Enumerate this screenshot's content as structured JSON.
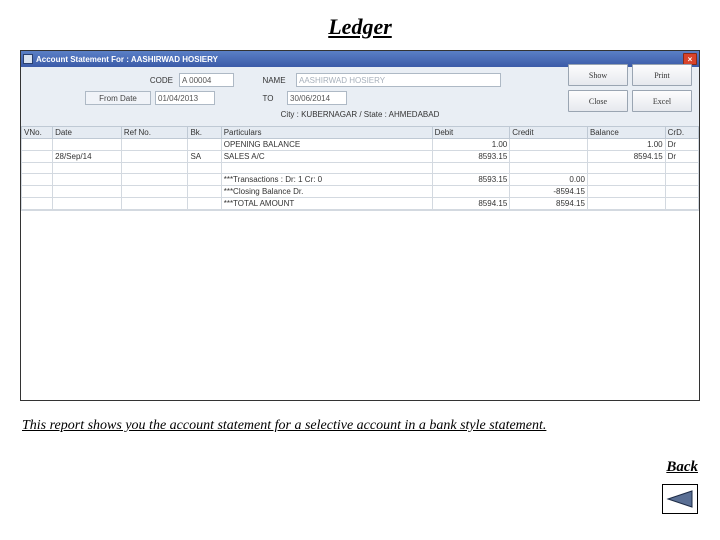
{
  "title": "Ledger",
  "window": {
    "title": "Account Statement For : AASHIRWAD HOSIERY",
    "form": {
      "code_label": "CODE",
      "code_value": "A 00004",
      "name_label": "NAME",
      "name_value": "AASHIRWAD HOSIERY",
      "from_date_label": "From Date",
      "from_date_value": "01/04/2013",
      "to_label": "TO",
      "to_date_value": "30/06/2014",
      "city_line": "City : KUBERNAGAR / State : AHMEDABAD"
    },
    "buttons": {
      "show": "Show",
      "print": "Print",
      "close": "Close",
      "excel": "Excel"
    },
    "columns": {
      "no": "VNo.",
      "date": "Date",
      "ref": "Ref No.",
      "bk": "Bk.",
      "part": "Particulars",
      "debit": "Debit",
      "credit": "Credit",
      "balance": "Balance",
      "crdr": "CrD."
    },
    "rows": [
      {
        "no": "",
        "date": "",
        "ref": "",
        "bk": "",
        "part": "OPENING BALANCE",
        "debit": "1.00",
        "credit": "",
        "bal": "1.00",
        "cd": "Dr"
      },
      {
        "no": "",
        "date": "28/Sep/14",
        "ref": "",
        "bk": "SA",
        "part": "SALES A/C",
        "debit": "8593.15",
        "credit": "",
        "bal": "8594.15",
        "cd": "Dr"
      },
      {
        "no": "",
        "date": "",
        "ref": "",
        "bk": "",
        "part": "",
        "debit": "",
        "credit": "",
        "bal": "",
        "cd": ""
      },
      {
        "no": "",
        "date": "",
        "ref": "",
        "bk": "",
        "part": "***Transactions : Dr: 1  Cr: 0",
        "debit": "8593.15",
        "credit": "0.00",
        "bal": "",
        "cd": ""
      },
      {
        "no": "",
        "date": "",
        "ref": "",
        "bk": "",
        "part": "***Closing Balance Dr.",
        "debit": "",
        "credit": "-8594.15",
        "bal": "",
        "cd": ""
      },
      {
        "no": "",
        "date": "",
        "ref": "",
        "bk": "",
        "part": "***TOTAL AMOUNT",
        "debit": "8594.15",
        "credit": "8594.15",
        "bal": "",
        "cd": ""
      }
    ]
  },
  "caption": "This report shows you the account statement for a selective account in a bank style statement.",
  "back": "Back"
}
